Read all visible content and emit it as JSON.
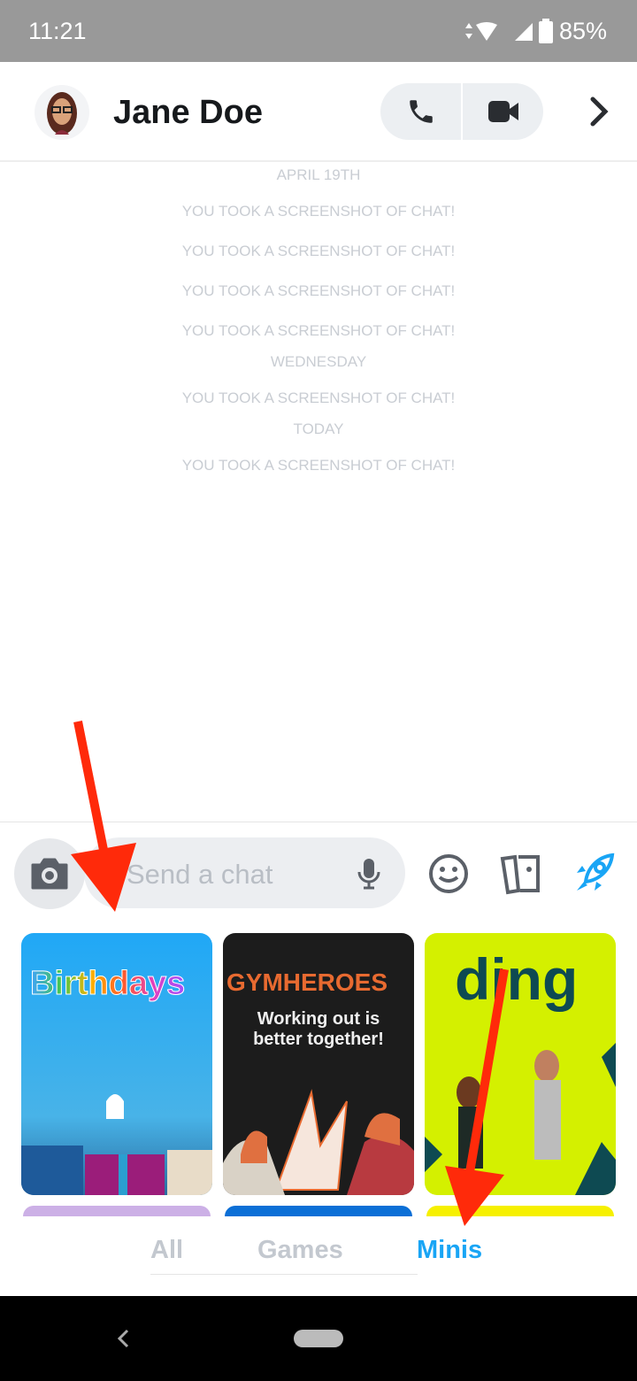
{
  "status_bar": {
    "time": "11:21",
    "battery": "85%"
  },
  "header": {
    "contact_name": "Jane Doe",
    "icons": [
      "avatar",
      "phone-icon",
      "video-camera-icon",
      "chevron-right-icon"
    ]
  },
  "messages": [
    {
      "text": "APRIL 19TH",
      "type": "date"
    },
    {
      "text": "YOU TOOK A SCREENSHOT OF CHAT!",
      "type": "event"
    },
    {
      "text": "YOU TOOK A SCREENSHOT OF CHAT!",
      "type": "event"
    },
    {
      "text": "YOU TOOK A SCREENSHOT OF CHAT!",
      "type": "event"
    },
    {
      "text": "YOU TOOK A SCREENSHOT OF CHAT!",
      "type": "event"
    },
    {
      "text": "WEDNESDAY",
      "type": "date"
    },
    {
      "text": "YOU TOOK A SCREENSHOT OF CHAT!",
      "type": "event"
    },
    {
      "text": "TODAY",
      "type": "date"
    },
    {
      "text": "YOU TOOK A SCREENSHOT OF CHAT!",
      "type": "event"
    }
  ],
  "composer": {
    "placeholder": "Send a chat",
    "icons": [
      "camera-icon",
      "microphone-icon",
      "smiley-icon",
      "cards-icon",
      "rocket-icon"
    ],
    "accent": "#19a5f5"
  },
  "minis": [
    {
      "title": "Birthdays"
    },
    {
      "title": "GYMHEROES",
      "subtitle": "Working out is better together!"
    },
    {
      "title": "ding"
    }
  ],
  "tabs": [
    {
      "label": "All"
    },
    {
      "label": "Games"
    },
    {
      "label": "Minis",
      "active": true
    }
  ],
  "colors": {
    "active_tab": "#19a5f5",
    "arrow": "#ff2a0a"
  }
}
